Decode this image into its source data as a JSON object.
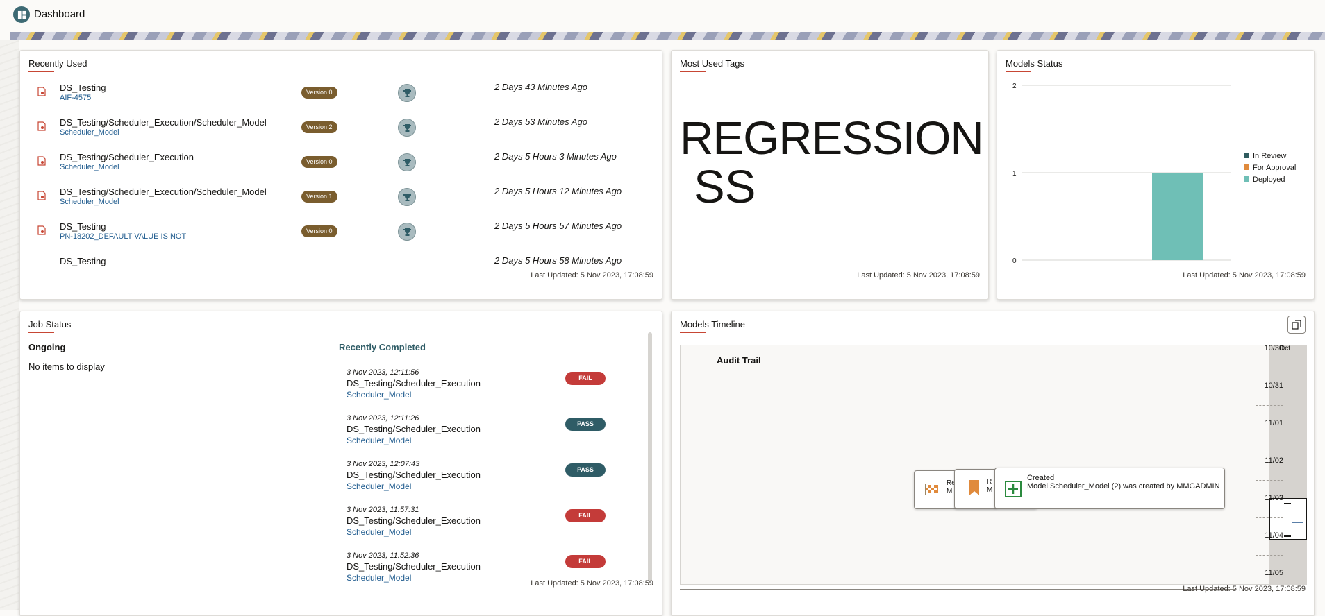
{
  "app": {
    "title": "Dashboard",
    "icon": "dashboard-icon"
  },
  "recently_used": {
    "title": "Recently Used",
    "items": [
      {
        "name": "DS_Testing",
        "sub": "AIF-4575",
        "version": "Version 0",
        "time": "2 Days 43 Minutes Ago"
      },
      {
        "name": "DS_Testing/Scheduler_Execution/Scheduler_Model",
        "sub": "Scheduler_Model",
        "version": "Version 2",
        "time": "2 Days 53 Minutes Ago"
      },
      {
        "name": "DS_Testing/Scheduler_Execution",
        "sub": "Scheduler_Model",
        "version": "Version 0",
        "time": "2 Days 5 Hours 3 Minutes Ago"
      },
      {
        "name": "DS_Testing/Scheduler_Execution/Scheduler_Model",
        "sub": "Scheduler_Model",
        "version": "Version 1",
        "time": "2 Days 5 Hours 12 Minutes Ago"
      },
      {
        "name": "DS_Testing",
        "sub": "PN-18202_DEFAULT VALUE IS NOT",
        "version": "Version 0",
        "time": "2 Days 5 Hours 57 Minutes Ago"
      },
      {
        "name": "DS_Testing",
        "sub": "",
        "version": "",
        "time": "2 Days 5 Hours 58 Minutes Ago"
      }
    ],
    "updated": "Last Updated: 5 Nov 2023, 17:08:59"
  },
  "most_used_tags": {
    "title": "Most Used Tags",
    "line1": "REGRESSION",
    "line2": "SS",
    "updated": "Last Updated: 5 Nov 2023, 17:08:59"
  },
  "models_status": {
    "title": "Models Status",
    "updated": "Last Updated: 5 Nov 2023, 17:08:59",
    "colors": {
      "in_review": "#2f5c5f",
      "for_approval": "#e08a3c",
      "deployed": "#6fbfb6"
    }
  },
  "chart_data": {
    "type": "bar",
    "categories": [
      ""
    ],
    "series": [
      {
        "name": "In Review",
        "values": [
          0
        ]
      },
      {
        "name": "For Approval",
        "values": [
          0
        ]
      },
      {
        "name": "Deployed",
        "values": [
          1
        ]
      }
    ],
    "yticks": [
      "0",
      "1",
      "2"
    ],
    "ylim": [
      0,
      2
    ],
    "legend": "right",
    "grid": true
  },
  "job_status": {
    "title": "Job Status",
    "ongoing_title": "Ongoing",
    "ongoing_empty": "No items to display",
    "completed_title": "Recently Completed",
    "jobs": [
      {
        "date": "3 Nov 2023, 12:11:56",
        "name": "DS_Testing/Scheduler_Execution",
        "sub": "Scheduler_Model",
        "status": "FAIL"
      },
      {
        "date": "3 Nov 2023, 12:11:26",
        "name": "DS_Testing/Scheduler_Execution",
        "sub": "Scheduler_Model",
        "status": "PASS"
      },
      {
        "date": "3 Nov 2023, 12:07:43",
        "name": "DS_Testing/Scheduler_Execution",
        "sub": "Scheduler_Model",
        "status": "PASS"
      },
      {
        "date": "3 Nov 2023, 11:57:31",
        "name": "DS_Testing/Scheduler_Execution",
        "sub": "Scheduler_Model",
        "status": "FAIL"
      },
      {
        "date": "3 Nov 2023, 11:52:36",
        "name": "DS_Testing/Scheduler_Execution",
        "sub": "Scheduler_Model",
        "status": "FAIL"
      }
    ],
    "status_colors": {
      "FAIL": "#c43b39",
      "PASS": "#2f5c66"
    },
    "updated": "Last Updated: 5 Nov 2023, 17:08:59"
  },
  "models_timeline": {
    "title": "Models Timeline",
    "audit_title": "Audit Trail",
    "dates": [
      "10/30",
      "10/31",
      "11/01",
      "11/02",
      "11/03",
      "11/04",
      "11/05"
    ],
    "month": "Oct",
    "event_main_title": "Created",
    "event_main_desc": "Model Scheduler_Model (2) was created by MMGADMIN",
    "event_cut1": "Re",
    "event_cut1b": "M",
    "event_cut2": "R",
    "event_cut2b": "M",
    "updated": "Last Updated: 5 Nov 2023, 17:08:59"
  }
}
